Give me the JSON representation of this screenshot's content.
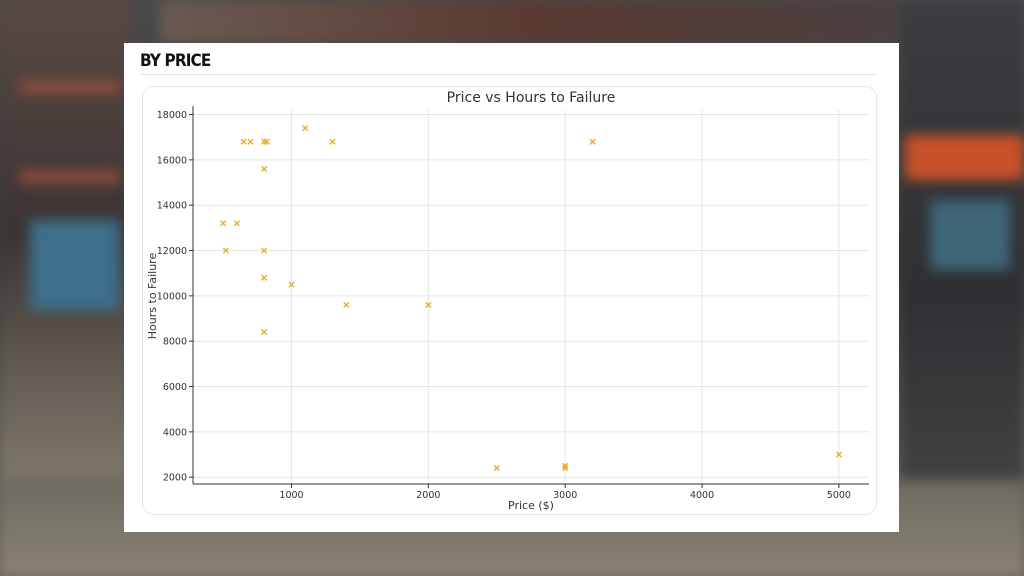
{
  "page": {
    "heading": "BY PRICE"
  },
  "colors": {
    "marker": "#f0a830",
    "axis": "#333333",
    "grid": "#e4e4e4",
    "text": "#333333"
  },
  "chart_data": {
    "type": "scatter",
    "title": "Price vs Hours to Failure",
    "xlabel": "Price ($)",
    "ylabel": "Hours to Failure",
    "xlim": [
      280,
      5220
    ],
    "ylim": [
      1700,
      18200
    ],
    "xticks": [
      1000,
      2000,
      3000,
      4000,
      5000
    ],
    "yticks": [
      2000,
      4000,
      6000,
      8000,
      10000,
      12000,
      14000,
      16000,
      18000
    ],
    "grid": true,
    "marker": "x",
    "x": [
      500,
      520,
      600,
      650,
      700,
      800,
      800,
      800,
      800,
      800,
      820,
      1000,
      1100,
      1300,
      1400,
      2000,
      2500,
      3000,
      3000,
      3200,
      5000
    ],
    "y": [
      13200,
      12000,
      13200,
      16800,
      16800,
      15600,
      12000,
      10800,
      8400,
      16800,
      16800,
      10500,
      17400,
      16800,
      9600,
      9600,
      2400,
      2400,
      2500,
      16800,
      3000
    ]
  }
}
